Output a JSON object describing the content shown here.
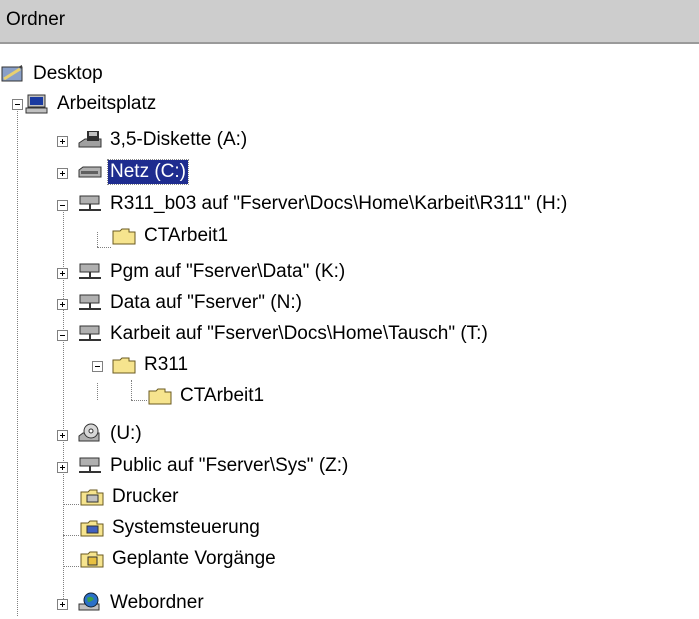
{
  "header": {
    "title": "Ordner"
  },
  "tree": {
    "items": [
      {
        "label": "Desktop",
        "icon": "desktop-icon"
      },
      {
        "label": "Arbeitsplatz",
        "icon": "computer-icon"
      },
      {
        "label": "3,5-Diskette (A:)",
        "icon": "floppy-drive-icon"
      },
      {
        "label": "Netz (C:)",
        "icon": "hard-drive-icon",
        "selected": true
      },
      {
        "label": "R311_b03 auf \"Fserver\\Docs\\Home\\Karbeit\\R311\" (H:)",
        "icon": "network-drive-icon"
      },
      {
        "label": "CTArbeit1",
        "icon": "folder-icon"
      },
      {
        "label": "Pgm auf \"Fserver\\Data\" (K:)",
        "icon": "network-drive-icon"
      },
      {
        "label": "Data auf \"Fserver\" (N:)",
        "icon": "network-drive-icon"
      },
      {
        "label": "Karbeit auf \"Fserver\\Docs\\Home\\Tausch\" (T:)",
        "icon": "network-drive-icon"
      },
      {
        "label": "R311",
        "icon": "folder-icon"
      },
      {
        "label": "CTArbeit1",
        "icon": "folder-icon"
      },
      {
        "label": " (U:)",
        "icon": "cd-drive-icon"
      },
      {
        "label": "Public auf \"Fserver\\Sys\" (Z:)",
        "icon": "network-drive-icon"
      },
      {
        "label": "Drucker",
        "icon": "printers-folder-icon"
      },
      {
        "label": "Systemsteuerung",
        "icon": "control-panel-icon"
      },
      {
        "label": "Geplante Vorgänge",
        "icon": "scheduled-tasks-icon"
      },
      {
        "label": "Webordner",
        "icon": "web-folders-icon"
      }
    ]
  }
}
